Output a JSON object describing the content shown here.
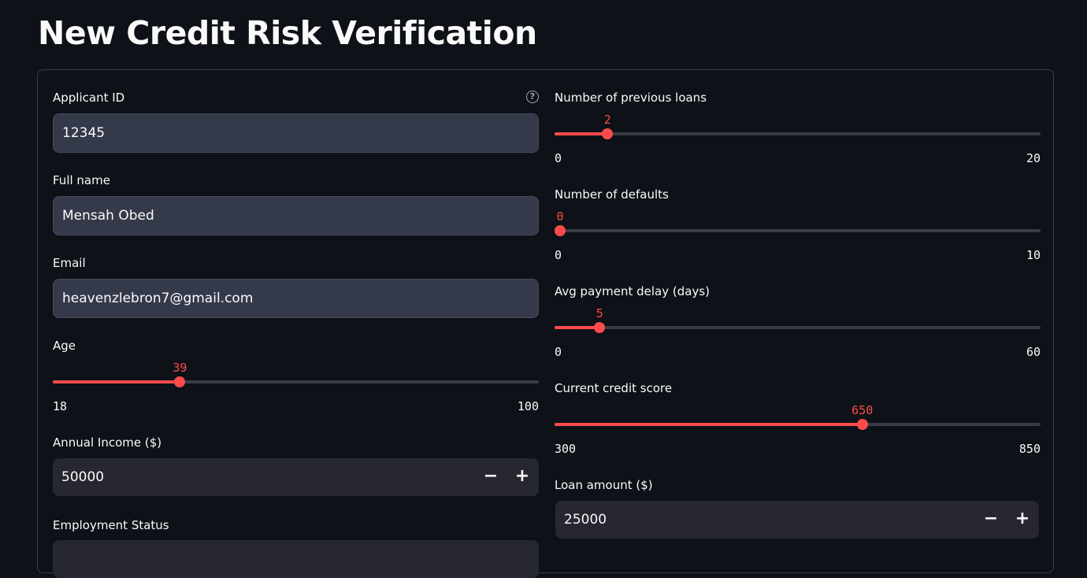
{
  "page": {
    "title": "New Credit Risk Verification"
  },
  "left": {
    "applicant_id": {
      "label": "Applicant ID",
      "value": "12345"
    },
    "full_name": {
      "label": "Full name",
      "value": "Mensah Obed"
    },
    "email": {
      "label": "Email",
      "value": "heavenzlebron7@gmail.com"
    },
    "age": {
      "label": "Age",
      "value": "39",
      "min": "18",
      "max": "100"
    },
    "annual_income": {
      "label": "Annual Income ($)",
      "value": "50000",
      "minus": "−",
      "plus": "+"
    },
    "employment_status": {
      "label": "Employment Status"
    }
  },
  "right": {
    "previous_loans": {
      "label": "Number of previous loans",
      "value": "2",
      "min": "0",
      "max": "20"
    },
    "defaults": {
      "label": "Number of defaults",
      "value": "0",
      "min": "0",
      "max": "10"
    },
    "payment_delay": {
      "label": "Avg payment delay (days)",
      "value": "5",
      "min": "0",
      "max": "60"
    },
    "credit_score": {
      "label": "Current credit score",
      "value": "650",
      "min": "300",
      "max": "850"
    },
    "loan_amount": {
      "label": "Loan amount ($)",
      "value": "25000",
      "minus": "−",
      "plus": "+"
    }
  },
  "colors": {
    "background": "#0e1117",
    "accent": "#ff4b4b",
    "input_bg": "#353a4b",
    "number_input_bg": "#262730"
  },
  "icons": {
    "help": "question-circle-icon",
    "decrement": "minus-icon",
    "increment": "plus-icon"
  }
}
